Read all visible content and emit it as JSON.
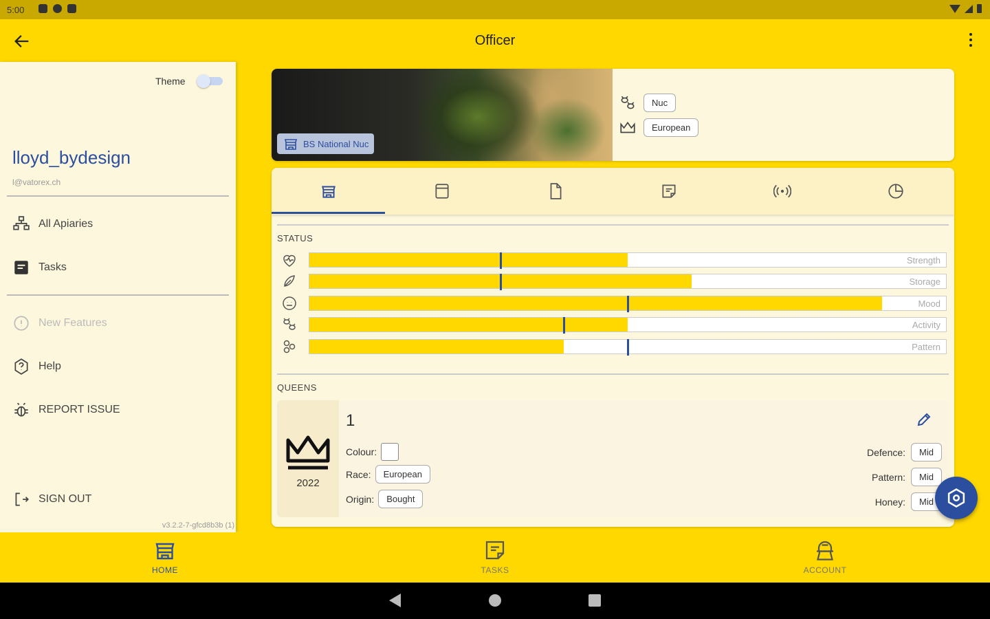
{
  "status_bar": {
    "time": "5:00"
  },
  "app_bar": {
    "title": "Officer"
  },
  "drawer": {
    "theme_label": "Theme",
    "username": "lloyd_bydesign",
    "email": "l@vatorex.ch",
    "items": [
      {
        "label": "All Apiaries",
        "icon": "apiaries-icon"
      },
      {
        "label": "Tasks",
        "icon": "tasks-icon"
      },
      {
        "label": "New Features",
        "icon": "new-features-icon"
      },
      {
        "label": "Help",
        "icon": "help-icon"
      },
      {
        "label": "REPORT ISSUE",
        "icon": "bug-icon"
      },
      {
        "label": "SIGN OUT",
        "icon": "sign-out-icon"
      }
    ],
    "version": "v3.2.2-7-gfcd8b3b (1)"
  },
  "hive": {
    "photo_tag": "BS National Nuc",
    "type_chip": "Nuc",
    "race_chip": "European"
  },
  "tabs": [
    "hive-tab",
    "box-tab",
    "document-tab",
    "notes-tab",
    "sensor-tab",
    "stats-tab"
  ],
  "status": {
    "section_label": "STATUS",
    "bars": [
      {
        "label": "Strength",
        "fill": 0.5,
        "marker": 0.3
      },
      {
        "label": "Storage",
        "fill": 0.6,
        "marker": 0.3
      },
      {
        "label": "Mood",
        "fill": 0.9,
        "marker": 0.5
      },
      {
        "label": "Activity",
        "fill": 0.5,
        "marker": 0.4
      },
      {
        "label": "Pattern",
        "fill": 0.4,
        "marker": 0.5
      }
    ]
  },
  "queens": {
    "section_label": "QUEENS",
    "queen": {
      "number": "1",
      "year": "2022",
      "colour_label": "Colour:",
      "race_label": "Race:",
      "race": "European",
      "origin_label": "Origin:",
      "origin": "Bought",
      "defence_label": "Defence:",
      "defence": "Mid",
      "pattern_label": "Pattern:",
      "pattern": "Mid",
      "honey_label": "Honey:",
      "honey": "Mid"
    }
  },
  "bottom_nav": {
    "home": "HOME",
    "tasks": "TASKS",
    "account": "ACCOUNT"
  },
  "colors": {
    "brand_yellow": "#FFD800",
    "accent_blue": "#2C4E9F",
    "panel": "#FDF8DD"
  }
}
